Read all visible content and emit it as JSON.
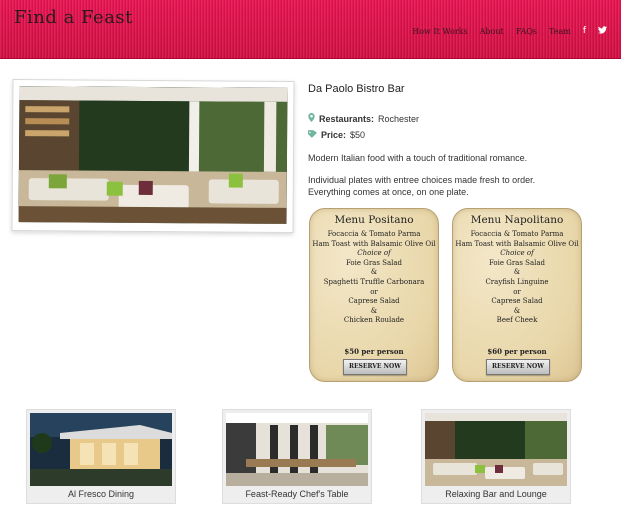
{
  "header": {
    "logo": "Find a Feast",
    "nav": [
      "How It Works",
      "About",
      "FAQs",
      "Team"
    ],
    "social": [
      "facebook-icon",
      "twitter-icon"
    ],
    "colors": {
      "banner": "#d90c45"
    }
  },
  "restaurant": {
    "name": "Da Paolo Bistro Bar",
    "restaurants_label": "Restaurants:",
    "restaurants_value": "Rochester",
    "price_label": "Price:",
    "price_value": "$50",
    "description_1": "Modern Italian food with a touch of traditional romance.",
    "description_2": "Individual plates with entree choices made fresh to order. Everything comes at once, on one plate."
  },
  "menus": [
    {
      "title": "Menu Positano",
      "items": [
        "Focaccia & Tomato Parma",
        "Ham Toast with Balsamic Olive Oil",
        "Choice of",
        "Foie Gras Salad",
        "&",
        "Spaghetti Truffle Carbonara",
        "or",
        "Caprese Salad",
        "&",
        "Chicken Roulade"
      ],
      "price": "$50 per person",
      "button": "RESERVE NOW"
    },
    {
      "title": "Menu Napolitano",
      "items": [
        "Focaccia & Tomato Parma",
        "Ham Toast with Balsamic Olive Oil",
        "Choice of",
        "Foie Gras Salad",
        "&",
        "Crayfish Linguine",
        "or",
        "Caprese Salad",
        "&",
        "Beef Cheek"
      ],
      "price": "$60 per person",
      "button": "RESERVE NOW"
    }
  ],
  "gallery": [
    {
      "caption": "Al Fresco Dining"
    },
    {
      "caption": "Feast-Ready Chef's Table"
    },
    {
      "caption": "Relaxing Bar and Lounge"
    }
  ]
}
